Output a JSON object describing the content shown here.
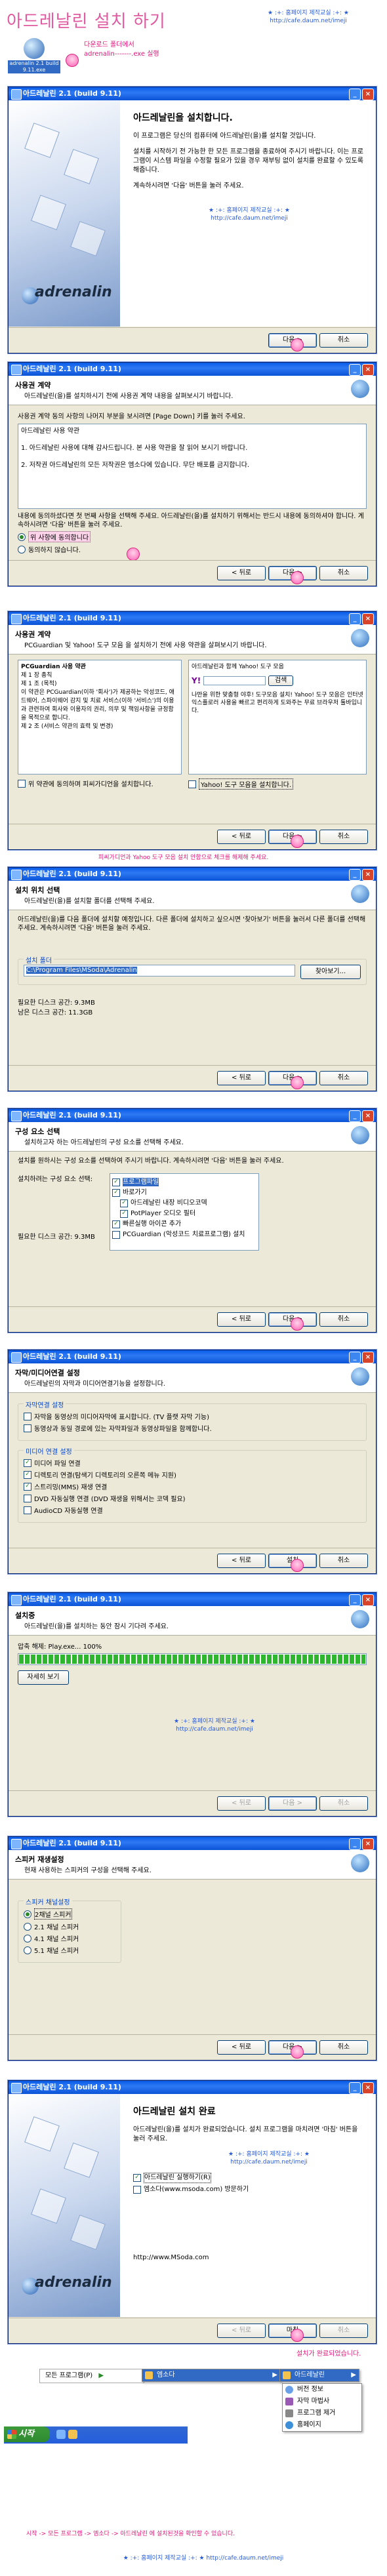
{
  "page": {
    "title": "아드레날린 설치 하기",
    "credit_line1": "★ :+: 홈페이지 제작교실 :+: ★",
    "credit_line2": "http://cafe.daum.net/imeji",
    "top_note_line1": "다운로드 폴더에서",
    "top_note_line2": "adrenalin-------.exe 실행",
    "desktop_icon_label": "adrenalin 2.1 build 9.11.exe",
    "note_yahoo": "피씨가디언과 Yahoo 도구 모음 설치 안함으로 체크를 해제해 주세요.",
    "note_finish": "설치가 완료되었습니다.",
    "note_start": "시작 -> 모든 프로그램 -> 엠소다 -> 아드레날린 에 설치된것을 확인할 수 있습니다."
  },
  "windows": {
    "title": "아드레날린 2.1 (build 9.11)",
    "welcome": {
      "heading": "아드레날린을 설치합니다.",
      "p1": "이 프로그램은 당신의 컴퓨터에 아드레날린(을)를 설치할 것입니다.",
      "p2": "설치를 시작하기 전 가능한 한 모든 프로그램을 종료하여 주시기 바랍니다. 이는 프로그램이 시스템 파일을 수정할 필요가 있을 경우 재부팅 없이 설치를 완료할 수 있도록 해줍니다.",
      "p3": "계속하시려면 '다음' 버튼을 눌러 주세요.",
      "brand": "adrenalin"
    },
    "license": {
      "h1": "사용권 계약",
      "h2": "아드레날린(을)를 설치하시기 전에 사용권 계약 내용을 살펴보시기 바랍니다.",
      "instr": "사용권 계약 동의 사항의 나머지 부분을 보시려면 [Page Down] 키를 눌러 주세요.",
      "text1": "아드레날린 사용 약관",
      "text2": "1. 아드레날린 사용에 대해 감사드립니다. 본 사용 약관을 잘 읽어 보시기 바랍니다.",
      "text3": "2. 저작권 아드레날린의 모든 저작권은 엠소다에 있습니다. 무단 배포를 금지합니다.",
      "text4": "내용에 동의하셨다면 첫 번째 사항을 선택해 주세요. 아드레날린(을)를 설치하기 위해서는 반드시 내용에 동의하셔야 합니다. 계속하시려면 '다음' 버튼을 눌러 주세요.",
      "opt_agree": "위 사항에 동의합니다",
      "opt_disagree": "동의하지 않습니다."
    },
    "yahoo": {
      "h1": "사용권 계약",
      "h2": "PCGuardian 및 Yahoo! 도구 모음 을 설치하기 전에 사용 약관을 살펴보시기 바랍니다.",
      "left_title": "PCGuardian 사용 약관",
      "left_text": "제 1 장 총칙\n제 1 조 (목적)\n이 약관은 PCGuardian(이하 '회사')가 제공하는 악성코드, 애드웨어, 스파이웨어 감지 및 치료 서비스(이하 '서비스')의 이용과 관련하여 회사와 이용자의 권리, 의무 및 책임사항을 규정함을 목적으로 합니다.\n제 2 조 (서비스 약관의 효력 및 변경)",
      "right_title": "아드레날린과 함께 Yahoo! 도구 모음",
      "right_text": "나만을 위한 맞춤형 야후! 도구모음 설치! Yahoo! 도구 모음은 인터넷 익스플로러 사용을 빠르고 편리하게 도와주는 무료 브라우저 툴바입니다.",
      "search_btn": "검색",
      "chk_left": "위 약관에 동의하며 피씨가디언을 설치합니다.",
      "chk_right": "Yahoo! 도구 모음을 설치합니다."
    },
    "location": {
      "h1": "설치 위치 선택",
      "h2": "아드레날린(을)를 설치할 폴더를 선택해 주세요.",
      "desc": "아드레날린(을)를 다음 폴더에 설치할 예정입니다. 다른 폴더에 설치하고 싶으시면 '찾아보기' 버튼을 눌러서 다른 폴더를 선택해 주세요. 계속하시려면 '다음' 버튼을 눌러 주세요.",
      "group_label": "설치 폴더",
      "path": "C:\\Program Files\\MSoda\\Adrenalin",
      "browse": "찾아보기...",
      "req": "필요한 디스크 공간: 9.3MB",
      "avail": "남은 디스크 공간: 11.3GB"
    },
    "components": {
      "h1": "구성 요소 선택",
      "h2": "설치하고자 하는 아드레날린의 구성 요소를 선택해 주세요.",
      "desc": "설치를 원하시는 구성 요소를 선택하여 주시기 바랍니다. 계속하시려면 '다음' 버튼을 눌러 주세요.",
      "sel_label": "설치하려는 구성 요소 선택:",
      "items": [
        "프로그램파일",
        "바로가기",
        "아드레날린 내장 비디오코덱",
        "PotPlayer 오디오 필터",
        "빠른실행 아이콘 추가",
        "PCGuardian (악성코드 치료프로그램) 설치"
      ],
      "req": "필요한 디스크 공간: 9.3MB"
    },
    "assoc": {
      "h1": "자막/미디어연결 설정",
      "h2": "아드레날린의 자막과 미디어연결기능을 설정합니다.",
      "g1": "자막연결 설정",
      "g1_items": [
        "자막을 동영상의 미디어자막에 표시합니다. (TV 플랫 자막 기능)",
        "동영상과 동일 경로에 있는 자막파일과 동영상파일을 함께합니다."
      ],
      "g2": "미디어 연결 설정",
      "g2_items": [
        "미디어 파일 연결",
        "디렉토리 연결(탐색기 디렉토리의 오른쪽 메뉴 지원)",
        "스트리밍(MMS) 재생 연결",
        "DVD 자동실행 연결 (DVD 재생을 위해서는 코덱 필요)",
        "AudioCD 자동실행 연결"
      ]
    },
    "installing": {
      "h1": "설치중",
      "h2": "아드레날린(을)를 설치하는 동안 잠시 기다려 주세요.",
      "status": "압축 해제: Play.exe... 100%",
      "details": "자세히 보기"
    },
    "speakers": {
      "h1": "스피커 재생설정",
      "h2": "현재 사용하는 스피커의 구성을 선택해 주세요.",
      "group": "스피커 채널설정",
      "opts": [
        "2채널 스피커",
        "2.1 채널 스피커",
        "4.1 채널 스피커",
        "5.1 채널 스피커"
      ]
    },
    "finish": {
      "heading": "아드레날린 설치 완료",
      "p1": "아드레날린(을)를 설치가 완료되었습니다. 설치 프로그램을 마치려면 '마침' 버튼을 눌러 주세요.",
      "chk1": "아드레날린 실행하기(R)",
      "chk2": "엠소다(www.msoda.com) 방문하기",
      "url": "http://www.MSoda.com"
    },
    "buttons": {
      "back": "< 뒤로",
      "next": "다음 >",
      "cancel": "취소",
      "install": "설치",
      "finish": "마침"
    }
  },
  "startmenu": {
    "all_programs": "모든 프로그램(P)",
    "start": "시작",
    "msoda": "엠소다",
    "adrenalin": "아드레날린",
    "sub": [
      "버전 정보",
      "자막 마법사",
      "프로그램 제거",
      "홈페이지"
    ]
  },
  "colors": {
    "pink": "#e05aa0",
    "blue": "#2a5bd7",
    "xp_title": "#0a5ce8"
  }
}
